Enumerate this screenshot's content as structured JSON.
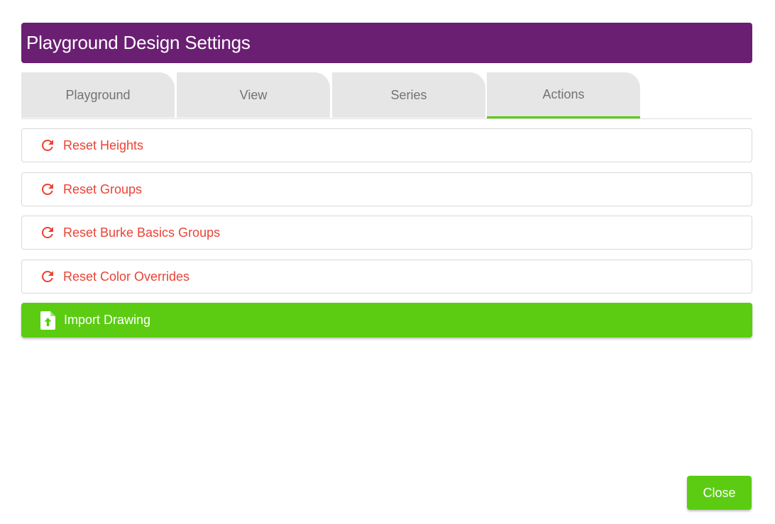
{
  "dialog": {
    "title": "Playground Design Settings"
  },
  "tabs": [
    {
      "label": "Playground",
      "active": false
    },
    {
      "label": "View",
      "active": false
    },
    {
      "label": "Series",
      "active": false
    },
    {
      "label": "Actions",
      "active": true
    }
  ],
  "actions": [
    {
      "label": "Reset Heights",
      "icon": "refresh-icon"
    },
    {
      "label": "Reset Groups",
      "icon": "refresh-icon"
    },
    {
      "label": "Reset Burke Basics Groups",
      "icon": "refresh-icon"
    },
    {
      "label": "Reset Color Overrides",
      "icon": "refresh-icon"
    }
  ],
  "import": {
    "label": "Import Drawing",
    "icon": "file-upload-icon"
  },
  "footer": {
    "close_label": "Close"
  },
  "colors": {
    "title_bar": "#6a1f72",
    "accent_green": "#5bcc12",
    "reset_red": "#ea4335",
    "tab_bg": "#e6e6e6"
  }
}
